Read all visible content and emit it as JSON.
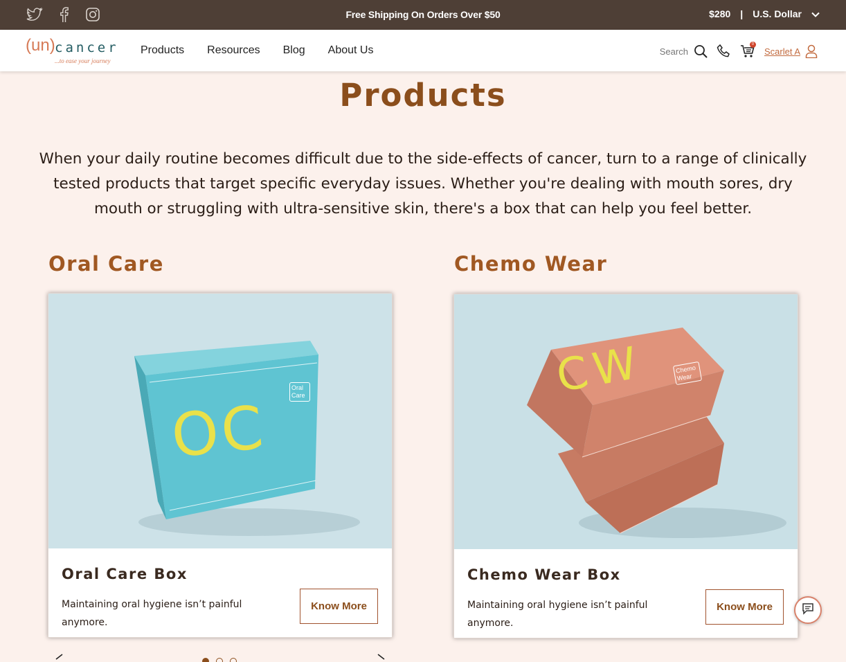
{
  "topbar": {
    "social_icons": [
      "twitter-icon",
      "facebook-icon",
      "instagram-icon"
    ],
    "shipping_text": "Free Shipping On Orders Over $50",
    "balance": "$280",
    "separator": "|",
    "currency": "U.S. Dollar"
  },
  "nav": {
    "logo": {
      "mark": "(un)",
      "word": "cancer",
      "tagline": "...to ease your journey"
    },
    "menu": [
      "Products",
      "Resources",
      "Blog",
      "About Us"
    ],
    "search_label": "Search",
    "cart_count": "0",
    "user_name": "Scarlet A"
  },
  "main": {
    "title": "Products",
    "intro": "When your daily routine becomes difficult due to the side-effects of cancer, turn to a range of clinically tested products that target specific everyday issues. Whether you're dealing with mouth sores, dry mouth or struggling with ultra-sensitive skin, there's a box that can help you feel better.",
    "sections": [
      {
        "heading": "Oral Care",
        "card": {
          "name": "Oral Care Box",
          "description": "Maintaining oral hygiene isn’t painful anymore.",
          "button": "Know More",
          "box_letters": "OC",
          "box_label": "Oral Care"
        }
      },
      {
        "heading": "Chemo Wear",
        "card": {
          "name": "Chemo Wear Box",
          "description": "Maintaining oral hygiene isn’t painful anymore.",
          "button": "Know More",
          "box_letters": "CW",
          "box_label": "Chemo Wear"
        }
      }
    ],
    "carousel": {
      "slides": 3,
      "active": 1
    }
  },
  "colors": {
    "topbar": "#4e3f36",
    "background": "#fcf1ec",
    "accent": "#8b4e1c",
    "oral_box": "#5fc4d2",
    "chemo_box": "#d48a70"
  }
}
